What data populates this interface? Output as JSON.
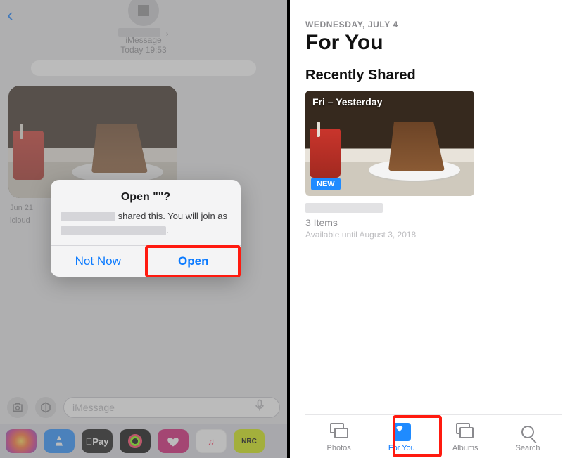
{
  "left": {
    "thread": {
      "service": "iMessage",
      "timestamp": "Today 19:53"
    },
    "bubble": {
      "date": "Jun 21",
      "subline": "icloud"
    },
    "dialog": {
      "title": "Open \"\"?",
      "text_mid": "shared this. You will",
      "text_prefix": "join as",
      "not_now": "Not Now",
      "open": "Open"
    },
    "compose": {
      "placeholder": "iMessage"
    },
    "appstrip": {
      "apay": "Pay",
      "nrc": "NRC",
      "music": "♫"
    }
  },
  "right": {
    "dateline": "WEDNESDAY, JULY 4",
    "title": "For You",
    "section": "Recently Shared",
    "card": {
      "range": "Fri – Yesterday",
      "new": "NEW",
      "count": "3 Items",
      "expiry": "Available until August 3, 2018"
    },
    "tabs": {
      "photos": "Photos",
      "foryou": "For You",
      "albums": "Albums",
      "search": "Search"
    }
  }
}
